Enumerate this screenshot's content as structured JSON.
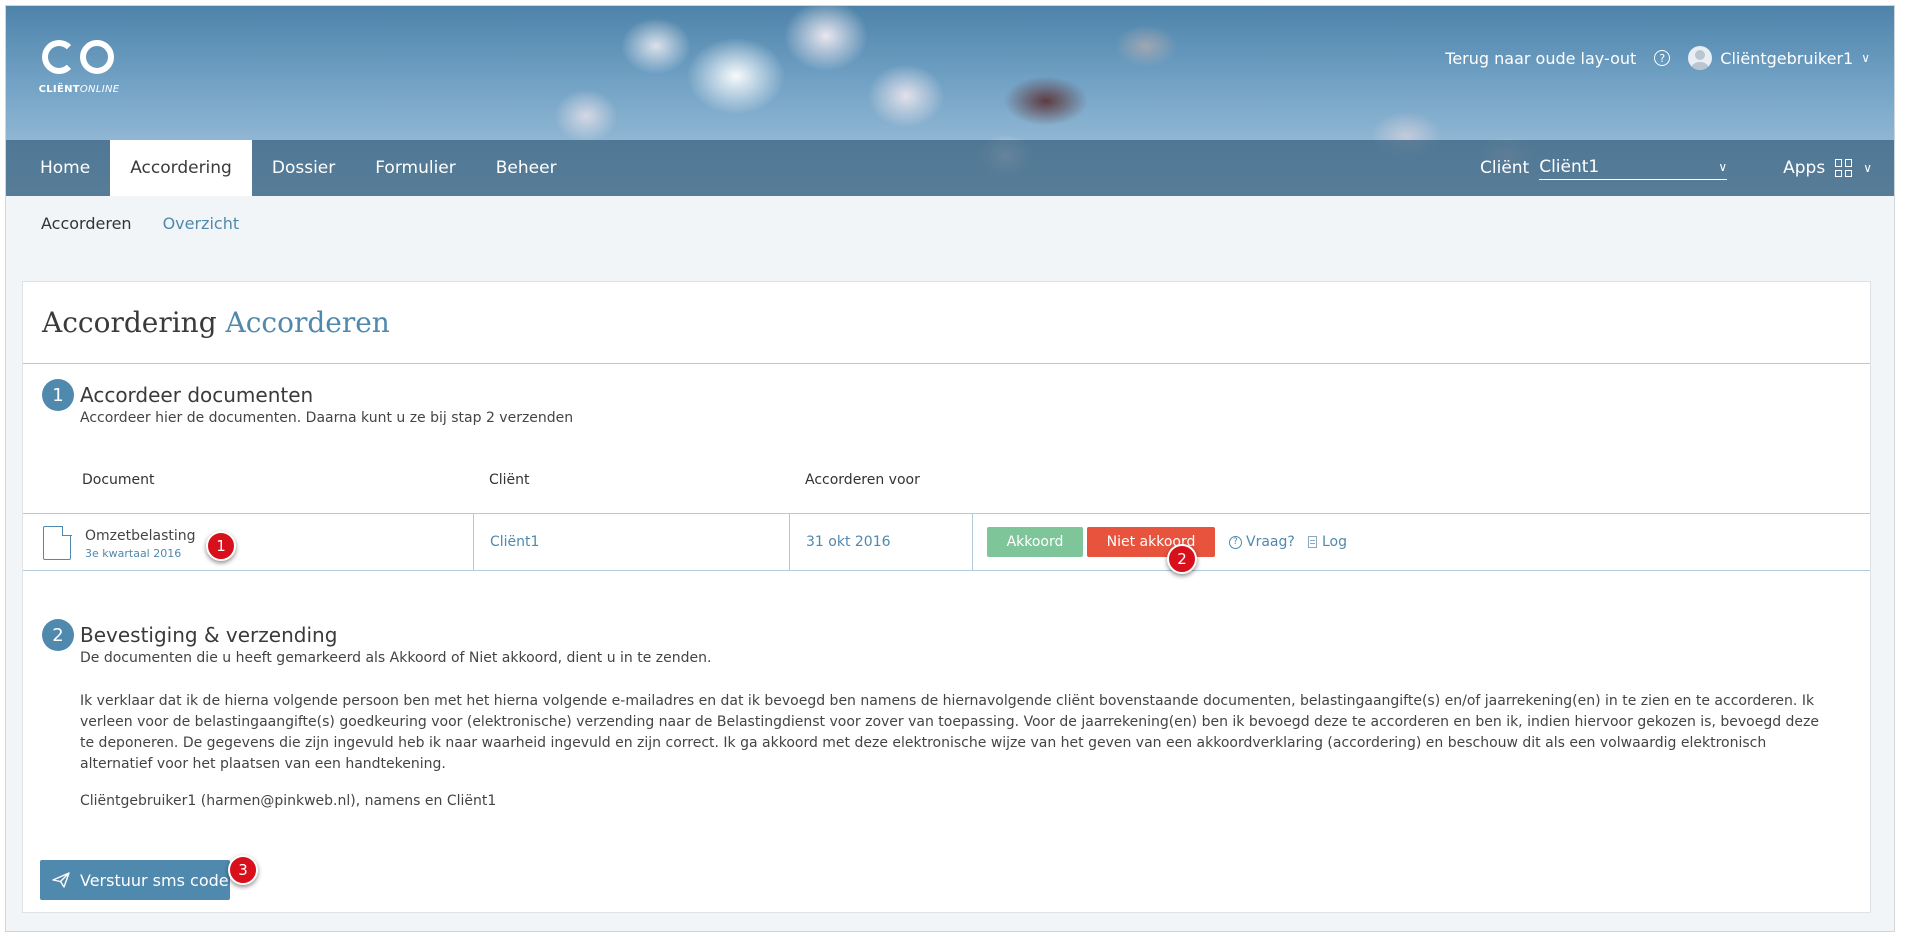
{
  "header": {
    "logo_text_bold": "CLIËNT",
    "logo_text_italic": "ONLINE",
    "old_layout_link": "Terug naar oude lay-out",
    "help_icon": "?",
    "user_name": "Cliëntgebruiker1"
  },
  "nav": {
    "tabs": [
      {
        "label": "Home"
      },
      {
        "label": "Accordering"
      },
      {
        "label": "Dossier"
      },
      {
        "label": "Formulier"
      },
      {
        "label": "Beheer"
      }
    ],
    "active_tab": "Accordering",
    "client_label": "Cliënt",
    "client_value": "Cliënt1",
    "apps_label": "Apps"
  },
  "subnav": {
    "items": [
      {
        "label": "Accorderen"
      },
      {
        "label": "Overzicht"
      }
    ]
  },
  "panel": {
    "title": "Accordering",
    "title_accent": "Accorderen",
    "step1": {
      "number": "1",
      "title": "Accordeer documenten",
      "subtitle": "Accordeer hier de documenten. Daarna kunt u ze bij stap 2 verzenden"
    },
    "table": {
      "headers": [
        "Document",
        "Cliënt",
        "Accorderen voor"
      ],
      "row": {
        "document": "Omzetbelasting",
        "period": "3e kwartaal 2016",
        "client": "Cliënt1",
        "deadline": "31 okt 2016",
        "approve_label": "Akkoord",
        "reject_label": "Niet akkoord",
        "question_label": "Vraag?",
        "log_label": "Log"
      }
    },
    "step2": {
      "number": "2",
      "title": "Bevestiging & verzending",
      "subtitle": "De documenten die u heeft gemarkeerd als Akkoord of Niet akkoord, dient u in te zenden.",
      "declaration": "Ik verklaar dat ik de hierna volgende persoon ben met het hierna volgende e-mailadres en dat ik bevoegd ben namens de hiernavolgende cliënt bovenstaande documenten, belastingaangifte(s) en/of jaarrekening(en) in te zien en te accorderen. Ik verleen voor de belastingaangifte(s) goedkeuring voor (elektronische) verzending naar de Belastingdienst voor zover van toepassing. Voor de jaarrekening(en) ben ik bevoegd deze te accorderen en ben ik, indien hiervoor gekozen is, bevoegd deze te deponeren. De gegevens die zijn ingevuld heb ik naar waarheid ingevuld en zijn correct. Ik ga akkoord met deze elektronische wijze van het geven van een akkoordverklaring (accordering) en beschouw dit als een volwaardig elektronisch alternatief voor het plaatsen van een handtekening.",
      "signer": "Cliëntgebruiker1 (harmen@pinkweb.nl), namens en Cliënt1"
    },
    "sms_button_label": "Verstuur sms code"
  },
  "markers": [
    "1",
    "2",
    "3"
  ],
  "colors": {
    "accent": "#4f89ad",
    "approve": "#7ec59a",
    "reject": "#e8533e",
    "marker": "#d7101c"
  }
}
